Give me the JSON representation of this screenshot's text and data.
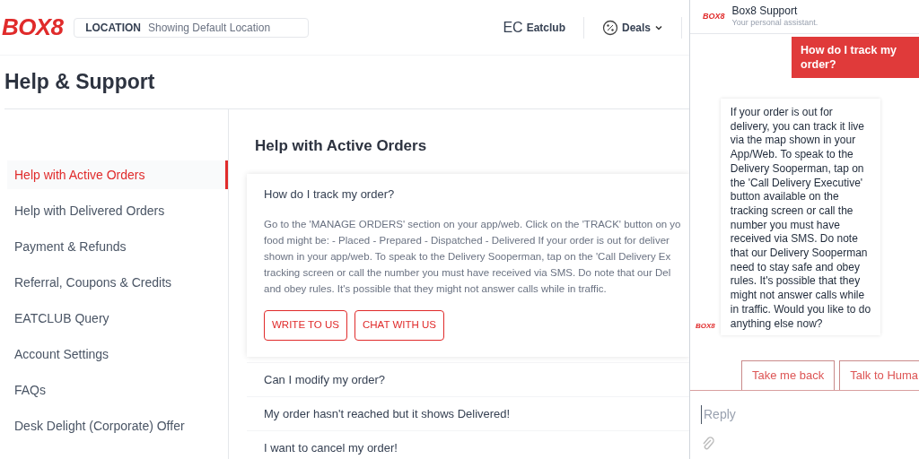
{
  "header": {
    "logo": "BOX8",
    "location_label": "LOCATION",
    "location_value": "Showing Default Location",
    "eatclub_mark": "EC",
    "eatclub": "Eatclub",
    "deals": "Deals"
  },
  "page_title": "Help & Support",
  "sidebar": {
    "items": [
      {
        "label": "Help with Active Orders",
        "selected": true
      },
      {
        "label": "Help with Delivered Orders",
        "selected": false
      },
      {
        "label": "Payment & Refunds",
        "selected": false
      },
      {
        "label": "Referral, Coupons & Credits",
        "selected": false
      },
      {
        "label": "EATCLUB Query",
        "selected": false
      },
      {
        "label": "Account Settings",
        "selected": false
      },
      {
        "label": "FAQs",
        "selected": false
      },
      {
        "label": "Desk Delight (Corporate) Offer",
        "selected": false
      }
    ]
  },
  "section_title": "Help with Active Orders",
  "faqs": [
    {
      "question": "How do I track my order?",
      "expanded": true,
      "answer_lines": [
        "Go to the 'MANAGE ORDERS' section on your app/web. Click on the 'TRACK' button on yo",
        "food might be: - Placed - Prepared - Dispatched - Delivered If your order is out for deliver",
        "shown in your app/web. To speak to the Delivery Sooperman, tap on the 'Call Delivery Ex",
        "tracking screen or call the number you must have received via SMS. Do note that our Del",
        "and obey rules. It's possible that they might not answer calls while in traffic."
      ],
      "buttons": [
        "WRITE TO US",
        "CHAT WITH US"
      ]
    },
    {
      "question": "Can I modify my order?",
      "expanded": false
    },
    {
      "question": "My order hasn't reached but it shows Delivered!",
      "expanded": false
    },
    {
      "question": "I want to cancel my order!",
      "expanded": false
    }
  ],
  "chat": {
    "logo": "BOX8",
    "title": "Box8 Support",
    "subtitle": "Your personal assistant.",
    "messages": [
      {
        "kind": "user",
        "text": "How do I track my order?"
      },
      {
        "kind": "bot",
        "avatar": "BOX8",
        "text": "If your order is out for delivery, you can track it live via the map shown in your App/Web. To speak to the Delivery Sooperman, tap on the 'Call Delivery Executive' button available on the tracking screen or call the number you must have received via SMS. Do note that our Delivery Sooperman need to stay safe and obey rules. It's possible that they might not answer calls while in traffic. Would you like to do anything else now?"
      }
    ],
    "quick_replies": [
      "Take me back",
      "Talk to Huma"
    ],
    "reply_placeholder": "Reply"
  }
}
